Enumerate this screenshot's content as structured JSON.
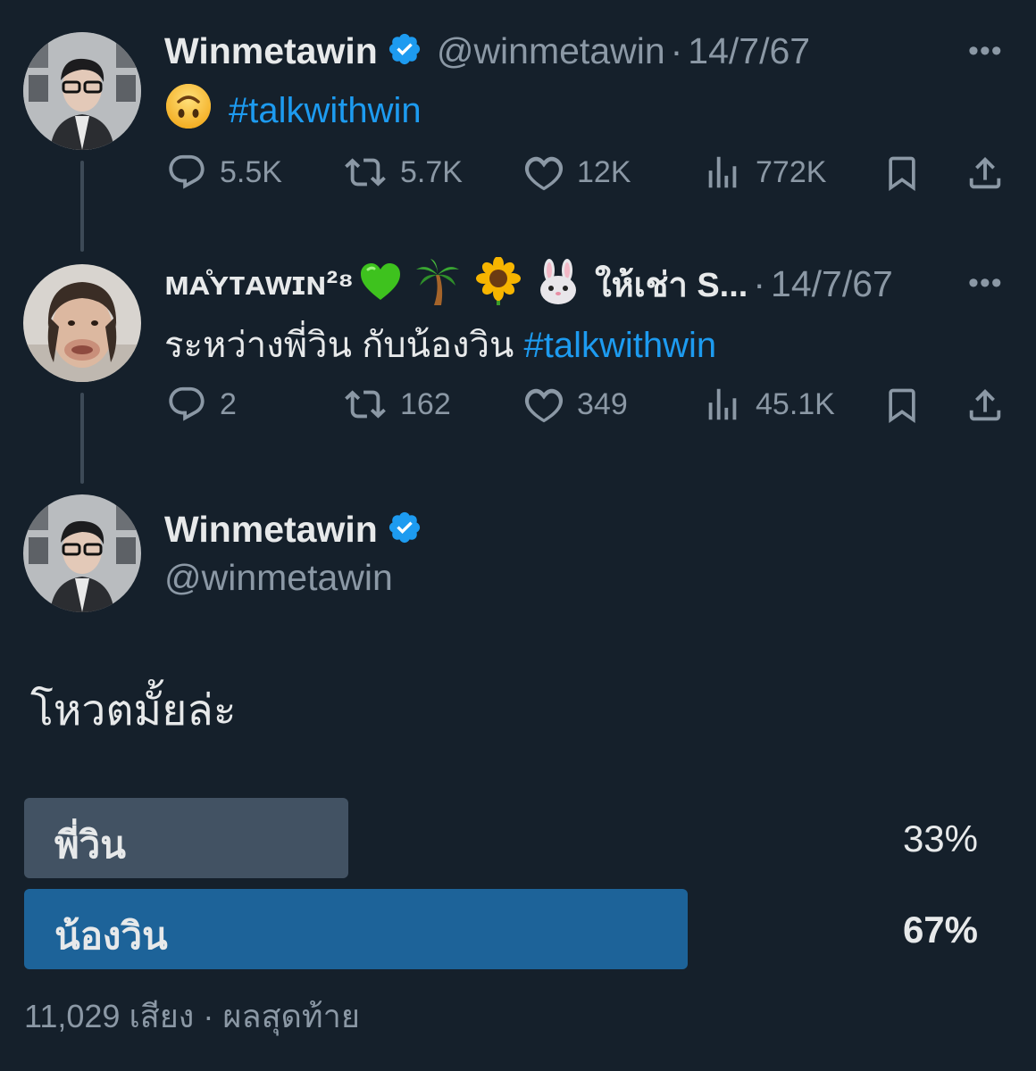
{
  "tweet1": {
    "author_name": "Winmetawin",
    "handle": "@winmetawin",
    "separator": "·",
    "date": "14/7/67",
    "text_emoji": "upside-down-face",
    "hashtag": "#talkwithwin",
    "more": "•••",
    "replies": "5.5K",
    "retweets": "5.7K",
    "likes": "12K",
    "views": "772K"
  },
  "tweet2": {
    "author_name": "ᴍᴀ̊ʏᴛᴀᴡɪɴ²⁸",
    "name_emojis": [
      "green-heart",
      "palm-tree",
      "sunflower",
      "rabbit-face"
    ],
    "name_suffix": "ให้เช่า S...",
    "separator": "·",
    "date": "14/7/67",
    "text": "ระหว่างพี่วิน กับน้องวิน ",
    "hashtag": "#talkwithwin",
    "more": "•••",
    "replies": "2",
    "retweets": "162",
    "likes": "349",
    "views": "45.1K"
  },
  "main_tweet": {
    "author_name": "Winmetawin",
    "handle": "@winmetawin",
    "text": "โหวตมั้ยล่ะ",
    "poll": {
      "options": [
        {
          "label": "พี่วิน",
          "percent_text": "33%",
          "percent": 33,
          "winner": false
        },
        {
          "label": "น้องวิน",
          "percent_text": "67%",
          "percent": 67,
          "winner": true
        }
      ],
      "votes": "11,029 เสียง",
      "separator": "·",
      "status": "ผลสุดท้าย"
    }
  },
  "colors": {
    "background": "#15202b",
    "text": "#e7e9ea",
    "muted": "#8b98a5",
    "link": "#1d9bf0",
    "verified": "#1d9bf0",
    "poll_winner": "#1d6399",
    "poll_other": "#425263"
  }
}
